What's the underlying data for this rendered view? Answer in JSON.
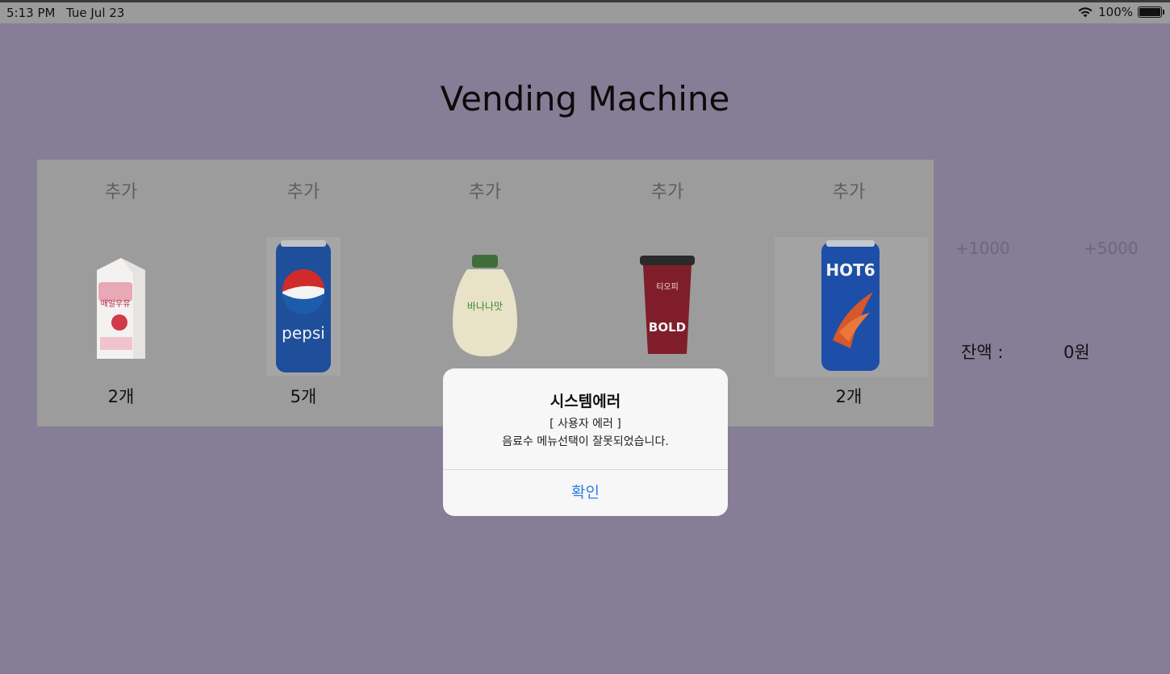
{
  "status_bar": {
    "time": "5:13 PM",
    "date": "Tue Jul 23",
    "battery": "100%"
  },
  "title": "Vending Machine",
  "products": [
    {
      "add_label": "추가",
      "stock": "2개",
      "name": "매일우유"
    },
    {
      "add_label": "추가",
      "stock": "5개",
      "name": "pepsi"
    },
    {
      "add_label": "추가",
      "stock": "",
      "name": "바나나맛우유"
    },
    {
      "add_label": "추가",
      "stock": "",
      "name": "BOLD"
    },
    {
      "add_label": "추가",
      "stock": "2개",
      "name": "HOT6"
    }
  ],
  "money": {
    "add_1000": "+1000",
    "add_5000": "+5000",
    "balance_label": "잔액 :",
    "balance_value": "0원"
  },
  "alert": {
    "title": "시스템에러",
    "message_line1": "[ 사용자 에러 ]",
    "message_line2": "음료수 메뉴선택이 잘못되었습니다.",
    "confirm": "확인"
  },
  "colors": {
    "background": "#857e96",
    "panel": "#9c9c9c",
    "alert_button": "#2f7fe0"
  }
}
